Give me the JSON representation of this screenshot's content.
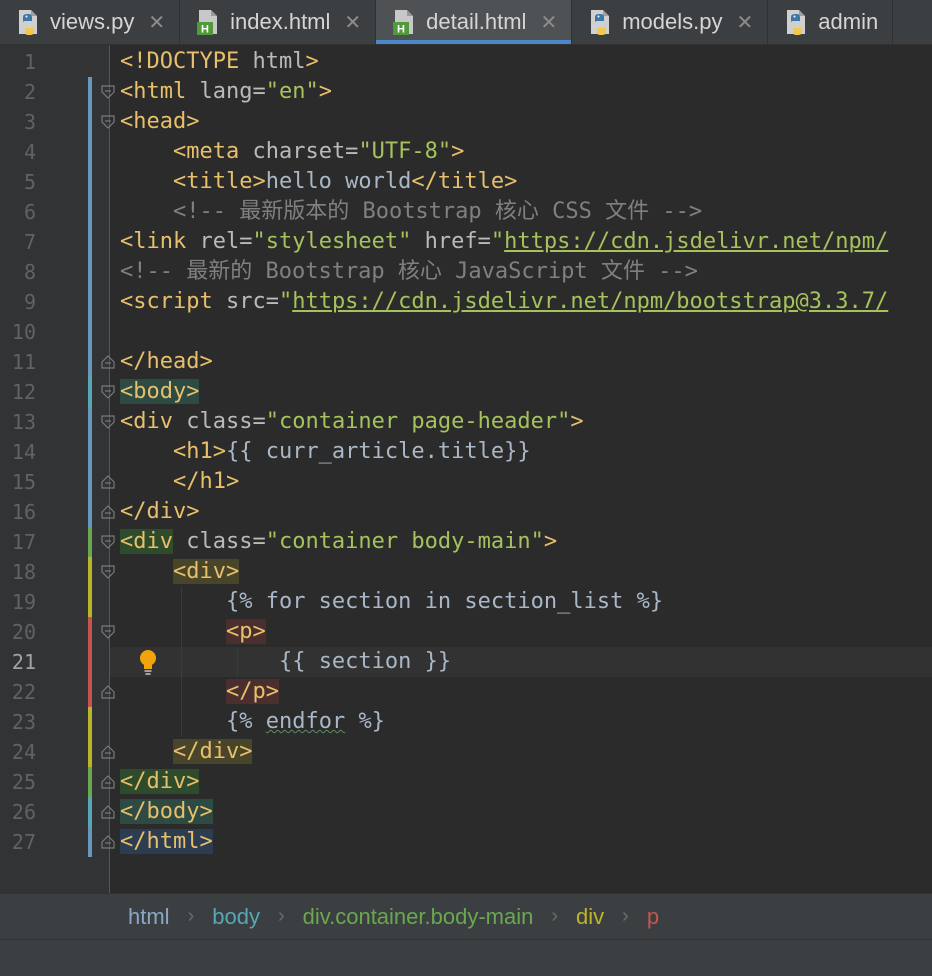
{
  "tabs": [
    {
      "label": "views.py",
      "icon": "python-file-icon",
      "active": false
    },
    {
      "label": "index.html",
      "icon": "html-file-icon",
      "active": false
    },
    {
      "label": "detail.html",
      "icon": "html-file-icon",
      "active": true
    },
    {
      "label": "models.py",
      "icon": "python-file-icon",
      "active": false
    },
    {
      "label": "admin",
      "icon": "python-file-icon",
      "active": false
    }
  ],
  "tab_close_glyph": "✕",
  "current_line": 21,
  "lines": [
    [
      {
        "c": "tag",
        "t": "<!DOCTYPE "
      },
      {
        "c": "attr",
        "t": "html"
      },
      {
        "c": "tag",
        "t": ">"
      }
    ],
    [
      {
        "c": "tag",
        "t": "<html "
      },
      {
        "c": "attr",
        "t": "lang="
      },
      {
        "c": "str",
        "t": "\"en\""
      },
      {
        "c": "tag",
        "t": ">"
      }
    ],
    [
      {
        "c": "tag",
        "t": "<head>"
      }
    ],
    [
      {
        "c": "txt",
        "t": "    "
      },
      {
        "c": "tag",
        "t": "<meta "
      },
      {
        "c": "attr",
        "t": "charset="
      },
      {
        "c": "str",
        "t": "\"UTF-8\""
      },
      {
        "c": "tag",
        "t": ">"
      }
    ],
    [
      {
        "c": "txt",
        "t": "    "
      },
      {
        "c": "tag",
        "t": "<title>"
      },
      {
        "c": "txt",
        "t": "hello world"
      },
      {
        "c": "tag",
        "t": "</title>"
      }
    ],
    [
      {
        "c": "txt",
        "t": "    "
      },
      {
        "c": "cmt",
        "t": "<!-- 最新版本的 Bootstrap 核心 CSS 文件 -->"
      }
    ],
    [
      {
        "c": "tag",
        "t": "<link "
      },
      {
        "c": "attr",
        "t": "rel="
      },
      {
        "c": "str",
        "t": "\"stylesheet\" "
      },
      {
        "c": "attr",
        "t": "href="
      },
      {
        "c": "str",
        "t": "\""
      },
      {
        "c": "link",
        "t": "https://cdn.jsdelivr.net/npm/"
      }
    ],
    [
      {
        "c": "cmt",
        "t": "<!-- 最新的 Bootstrap 核心 JavaScript 文件 -->"
      }
    ],
    [
      {
        "c": "tag",
        "t": "<script "
      },
      {
        "c": "attr",
        "t": "src="
      },
      {
        "c": "str",
        "t": "\""
      },
      {
        "c": "link",
        "t": "https://cdn.jsdelivr.net/npm/bootstrap@3.3.7/"
      }
    ],
    [],
    [
      {
        "c": "tag",
        "t": "</head>"
      }
    ],
    [
      {
        "c": "tag hl-body",
        "t": "<body>"
      }
    ],
    [
      {
        "c": "tag",
        "t": "<div "
      },
      {
        "c": "attr",
        "t": "class="
      },
      {
        "c": "str",
        "t": "\"container page-header\""
      },
      {
        "c": "tag",
        "t": ">"
      }
    ],
    [
      {
        "c": "txt",
        "t": "    "
      },
      {
        "c": "tag",
        "t": "<h1>"
      },
      {
        "c": "tpl",
        "t": "{{ curr_article.title}}"
      }
    ],
    [
      {
        "c": "txt",
        "t": "    "
      },
      {
        "c": "tag",
        "t": "</h1>"
      }
    ],
    [
      {
        "c": "tag",
        "t": "</div>"
      }
    ],
    [
      {
        "c": "tag hl-div",
        "t": "<div"
      },
      {
        "c": "attr",
        "t": " class="
      },
      {
        "c": "str",
        "t": "\"container body-main\""
      },
      {
        "c": "tag",
        "t": ">"
      }
    ],
    [
      {
        "c": "txt",
        "t": "    "
      },
      {
        "c": "tag hl-div2",
        "t": "<div>"
      }
    ],
    [
      {
        "c": "txt",
        "t": "        "
      },
      {
        "c": "tpl",
        "t": "{% for section in section_list %}"
      }
    ],
    [
      {
        "c": "txt",
        "t": "        "
      },
      {
        "c": "tag hl-p",
        "t": "<p>"
      }
    ],
    [
      {
        "c": "txt",
        "t": "            "
      },
      {
        "c": "tpl",
        "t": "{{ section }}"
      }
    ],
    [
      {
        "c": "txt",
        "t": "        "
      },
      {
        "c": "tag hl-p",
        "t": "</p>"
      }
    ],
    [
      {
        "c": "txt",
        "t": "        "
      },
      {
        "c": "tpl",
        "t": "{% "
      },
      {
        "c": "tpl squig",
        "t": "endfor"
      },
      {
        "c": "tpl",
        "t": " %}"
      }
    ],
    [
      {
        "c": "txt",
        "t": "    "
      },
      {
        "c": "tag hl-div2",
        "t": "</div>"
      }
    ],
    [
      {
        "c": "tag hl-div",
        "t": "</div>"
      }
    ],
    [
      {
        "c": "tag hl-body",
        "t": "</body>"
      }
    ],
    [
      {
        "c": "tag hl-html",
        "t": "</html>"
      }
    ]
  ],
  "breadcrumb": [
    {
      "label": "html",
      "color": "#8aa7c7"
    },
    {
      "label": "body",
      "color": "#56a8b5"
    },
    {
      "label": "div.container.body-main",
      "color": "#6aa84f"
    },
    {
      "label": "div",
      "color": "#bbb529"
    },
    {
      "label": "p",
      "color": "#c75450"
    }
  ],
  "breadcrumb_sep": "›",
  "colors": {
    "accent": "#4a88c7",
    "tag": "#e8bf6a",
    "string": "#a5c25c",
    "comment": "#808080",
    "bulb": "#f0a30a"
  }
}
